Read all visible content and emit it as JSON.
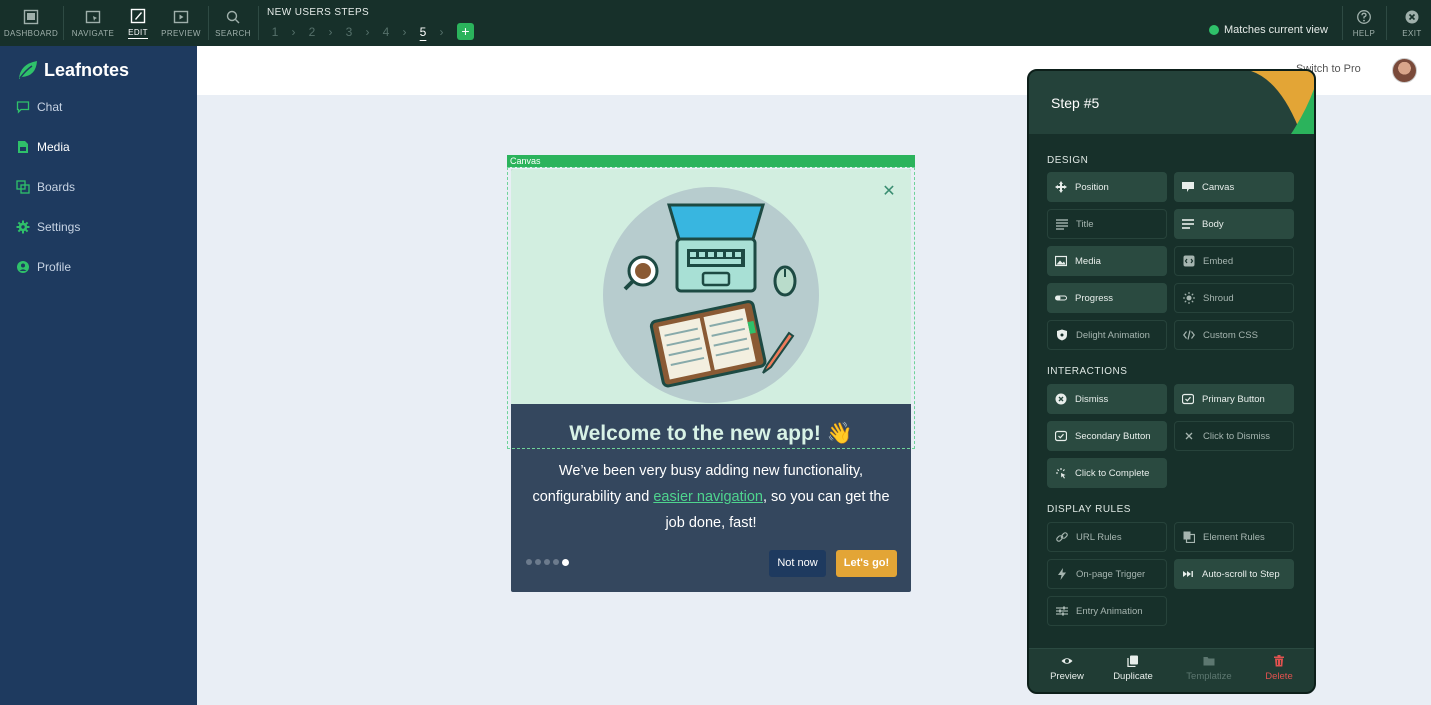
{
  "toolbar": {
    "tools": [
      {
        "label": "DASHBOARD",
        "icon": "dashboard-icon"
      },
      {
        "label": "NAVIGATE",
        "icon": "navigate-icon"
      },
      {
        "label": "EDIT",
        "icon": "edit-icon",
        "active": true
      },
      {
        "label": "PREVIEW",
        "icon": "preview-icon"
      },
      {
        "label": "SEARCH",
        "icon": "search-icon"
      }
    ],
    "flow_title": "NEW USERS STEPS",
    "steps": [
      "1",
      "2",
      "3",
      "4",
      "5"
    ],
    "current_step": "5",
    "add_step": "+",
    "match_status": "Matches current view",
    "help_label": "HELP",
    "exit_label": "EXIT"
  },
  "sidebar": {
    "brand": "Leafnotes",
    "items": [
      {
        "label": "Chat",
        "icon": "chat-icon"
      },
      {
        "label": "Media",
        "icon": "media-icon",
        "active": true
      },
      {
        "label": "Boards",
        "icon": "boards-icon"
      },
      {
        "label": "Settings",
        "icon": "gear-icon"
      },
      {
        "label": "Profile",
        "icon": "profile-icon"
      }
    ]
  },
  "header": {
    "switch_to_pro": "Switch to Pro"
  },
  "canvas": {
    "tag": "Canvas",
    "modal": {
      "title": "Welcome to the new app! 👋",
      "body_before": "We’ve been very busy adding new functionality, configurability and ",
      "body_link": "easier navigation",
      "body_after": ", so you can get the job done, fast!",
      "progress_current": 5,
      "progress_total": 5,
      "secondary_button": "Not now",
      "primary_button": "Let's go!"
    }
  },
  "panel": {
    "title": "Step #5",
    "sections": {
      "design": "DESIGN",
      "interactions": "INTERACTIONS",
      "display_rules": "DISPLAY RULES"
    },
    "design_items": [
      "Position",
      "Canvas",
      "Title",
      "Body",
      "Media",
      "Embed",
      "Progress",
      "Shroud",
      "Delight Animation",
      "Custom CSS"
    ],
    "interaction_items": [
      "Dismiss",
      "Primary Button",
      "Secondary Button",
      "Click to Dismiss",
      "Click to Complete"
    ],
    "rule_items": [
      "URL Rules",
      "Element Rules",
      "On-page Trigger",
      "Auto-scroll to Step",
      "Entry Animation"
    ],
    "footer": [
      "Preview",
      "Duplicate",
      "Templatize",
      "Delete"
    ]
  },
  "colors": {
    "toolbar_bg": "#17302a",
    "sidebar_bg": "#1e3a5f",
    "accent_green": "#2bb35c",
    "primary_button": "#e3a536",
    "danger": "#e0524f"
  }
}
